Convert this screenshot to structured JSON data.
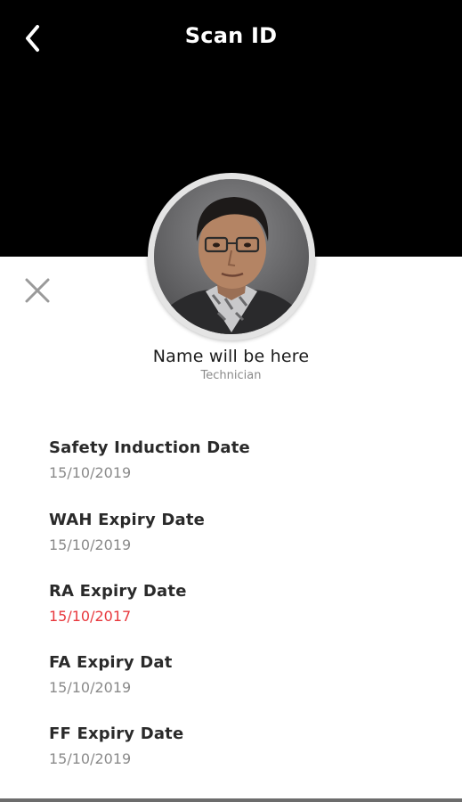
{
  "header": {
    "title": "Scan ID"
  },
  "profile": {
    "name": "Name will be here",
    "role": "Technician"
  },
  "details": [
    {
      "label": "Safety Induction Date",
      "value": "15/10/2019",
      "status": "valid"
    },
    {
      "label": "WAH Expiry Date",
      "value": "15/10/2019",
      "status": "valid"
    },
    {
      "label": "RA Expiry Date",
      "value": "15/10/2017",
      "status": "expired"
    },
    {
      "label": "FA Expiry Dat",
      "value": "15/10/2019",
      "status": "valid"
    },
    {
      "label": "FF Expiry Date",
      "value": "15/10/2019",
      "status": "valid"
    }
  ],
  "icons": {
    "back": "chevron-left-icon",
    "close": "close-icon"
  },
  "colors": {
    "header_bg": "#000000",
    "expired": "#e8383d",
    "muted": "#8a8a8a"
  }
}
